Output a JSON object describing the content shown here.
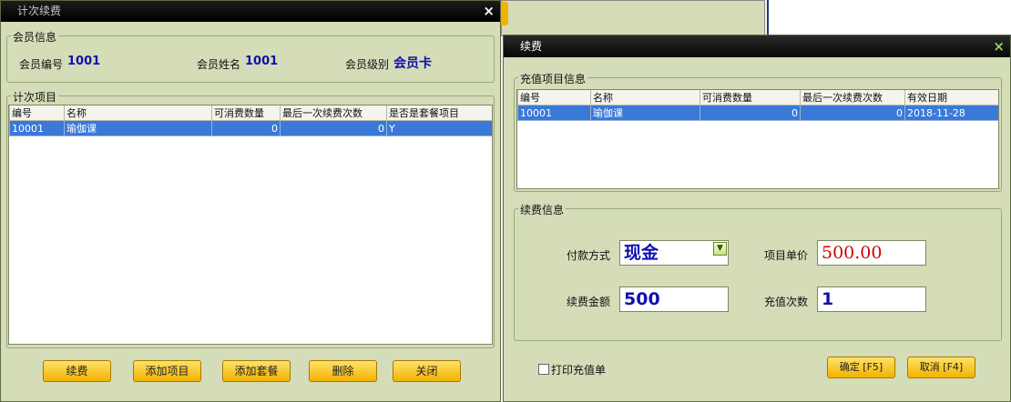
{
  "left_window": {
    "title": "计次续费",
    "close": "×",
    "member_group": {
      "label": "会员信息",
      "fields": [
        {
          "label": "会员编号",
          "value": "1001"
        },
        {
          "label": "会员姓名",
          "value": "1001"
        },
        {
          "label": "会员级别",
          "value": "会员卡"
        }
      ]
    },
    "items_group": {
      "label": "计次项目",
      "columns": [
        "编号",
        "名称",
        "可消费数量",
        "最后一次续费次数",
        "是否是套餐项目"
      ],
      "rows": [
        [
          "10001",
          "瑜伽课",
          "0",
          "0",
          "Y"
        ]
      ]
    },
    "buttons": [
      "续费",
      "添加项目",
      "添加套餐",
      "删除",
      "关闭"
    ]
  },
  "right_window": {
    "title": "续费",
    "close": "×",
    "recharge_group": {
      "label": "充值项目信息",
      "columns": [
        "编号",
        "名称",
        "可消费数量",
        "最后一次续费次数",
        "有效日期"
      ],
      "rows": [
        [
          "10001",
          "瑜伽课",
          "0",
          "0",
          "2018-11-28"
        ]
      ]
    },
    "renew_group": {
      "label": "续费信息",
      "payment_label": "付款方式",
      "payment_value": "现金",
      "unit_price_label": "项目单价",
      "unit_price_value": "500.00",
      "amount_label": "续费金额",
      "amount_value": "500",
      "count_label": "充值次数",
      "count_value": "1"
    },
    "print_label": "打印充值单",
    "print_checked": false,
    "ok_button": "确定 [F5]",
    "cancel_button": "取消 [F4]"
  },
  "colors": {
    "title_bg": "#000000",
    "panel_bg": "#d4dcb8",
    "selection": "#3a79d8",
    "button": "#f5c200",
    "value_blue": "#1010b0",
    "price_red": "#d00000"
  }
}
